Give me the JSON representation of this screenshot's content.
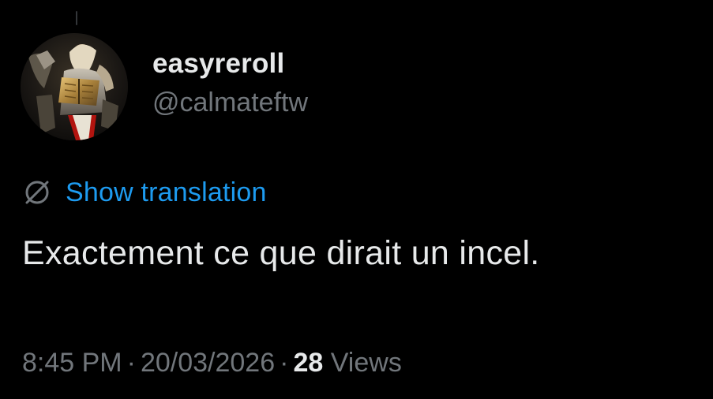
{
  "tweet": {
    "author": {
      "display_name": "easyreroll",
      "handle": "@calmateftw",
      "avatar_icon": "fantasy-knight-avatar"
    },
    "translation": {
      "icon": "translate-globe-icon",
      "label": "Show translation"
    },
    "text": "Exactement ce que dirait un incel.",
    "meta": {
      "time": "8:45 PM",
      "separator": "·",
      "date": "20/03/2026",
      "views_count": "28",
      "views_label": "Views"
    }
  },
  "colors": {
    "background": "#000000",
    "primary_text": "#e7e9ea",
    "secondary_text": "#71767b",
    "link": "#1d9bf0"
  }
}
